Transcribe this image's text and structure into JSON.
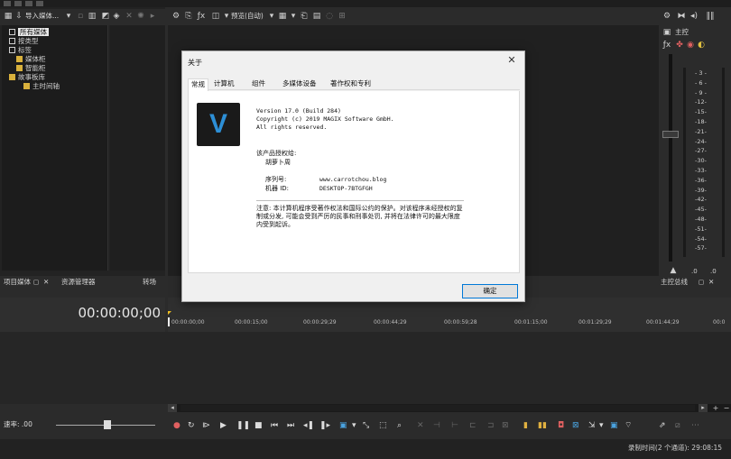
{
  "explorer": {
    "toolbar": {
      "import_label": "导入媒体..."
    },
    "tree": [
      {
        "label": "所有媒体",
        "selected": true
      },
      {
        "label": "按类型",
        "selected": false
      },
      {
        "label": "标签",
        "selected": false
      },
      {
        "label": "媒体柜",
        "selected": false
      },
      {
        "label": "智能柜",
        "selected": false
      },
      {
        "label": "故事板库",
        "selected": false
      },
      {
        "label": "主时间轴",
        "selected": false
      }
    ],
    "tabs": {
      "project_media": "项目媒体",
      "explorer": "资源管理器",
      "transitions": "转场"
    }
  },
  "preview": {
    "mode_label": "预览(自动)"
  },
  "master": {
    "title": "主控",
    "scale": [
      "- 3 -",
      "- 6 -",
      "- 9 -",
      "-12-",
      "-15-",
      "-18-",
      "-21-",
      "-24-",
      "-27-",
      "-30-",
      "-33-",
      "-36-",
      "-39-",
      "-42-",
      "-45-",
      "-48-",
      "-51-",
      "-54-",
      "-57-"
    ],
    "db_left": ".0",
    "db_right": ".0",
    "tab_label": "主控总线"
  },
  "timeline": {
    "timecode": "00:00:00;00",
    "ruler": [
      "00:00:00;00",
      "00:00:15;00",
      "00:00:29;29",
      "00:00:44;29",
      "00:00:59;28",
      "00:01:15;00",
      "00:01:29;29",
      "00:01:44;29",
      "00:0"
    ]
  },
  "transport": {
    "rate_label": "速率: .00"
  },
  "status": {
    "record_time": "录制时间(2 个通道): 29:08:15"
  },
  "dialog": {
    "title": "关于",
    "close_glyph": "✕",
    "tabs": [
      "常规",
      "计算机",
      "组件",
      "多媒体设备",
      "著作权和专利"
    ],
    "logo_letter": "V",
    "version": "Version 17.0 (Build 284)",
    "copyright": "Copyright (c) 2019 MAGIX Software GmbH.",
    "rights": "All rights reserved.",
    "licensed_to_label": "该产品授权给:",
    "licensed_to_name": "胡萝卜周",
    "serial_label": "序列号:",
    "serial_value": "www.carrotchou.blog",
    "machine_label": "机器 ID:",
    "machine_value": "DESKTOP-7BTGFGH",
    "notice": "注意: 本计算机程序受著作权法和国际公约的保护。对该程序未经授权的复制或分发, 可能会受到严厉的民事和刑事处罚, 并将在法律许可的最大限度内受到起诉。",
    "ok_label": "确定"
  }
}
